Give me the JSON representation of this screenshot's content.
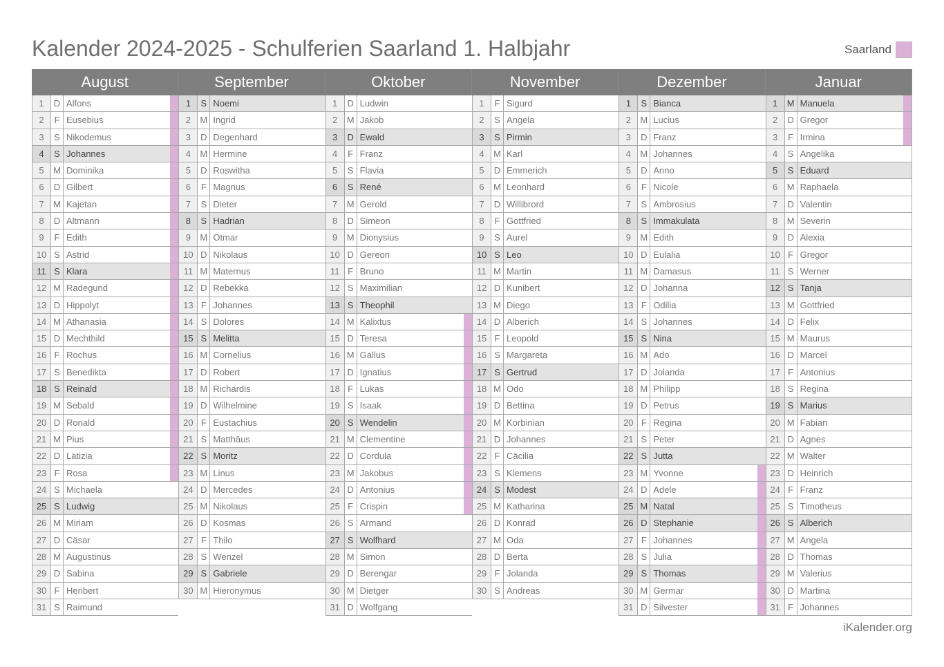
{
  "title": "Kalender 2024-2025 - Schulferien Saarland 1. Halbjahr",
  "legend": {
    "label": "Saarland",
    "color": "#dbb1d8"
  },
  "footer": "iKalender.org",
  "months": [
    {
      "name": "August",
      "days": [
        [
          "1",
          "D",
          "Alfons"
        ],
        [
          "2",
          "F",
          "Eusebius"
        ],
        [
          "3",
          "S",
          "Nikodemus"
        ],
        [
          "4",
          "S",
          "Johannes"
        ],
        [
          "5",
          "M",
          "Dominika"
        ],
        [
          "6",
          "D",
          "Gilbert"
        ],
        [
          "7",
          "M",
          "Kajetan"
        ],
        [
          "8",
          "D",
          "Altmann"
        ],
        [
          "9",
          "F",
          "Edith"
        ],
        [
          "10",
          "S",
          "Astrid"
        ],
        [
          "11",
          "S",
          "Klara"
        ],
        [
          "12",
          "M",
          "Radegund"
        ],
        [
          "13",
          "D",
          "Hippolyt"
        ],
        [
          "14",
          "M",
          "Athanasia"
        ],
        [
          "15",
          "D",
          "Mechthild"
        ],
        [
          "16",
          "F",
          "Rochus"
        ],
        [
          "17",
          "S",
          "Benedikta"
        ],
        [
          "18",
          "S",
          "Reinald"
        ],
        [
          "19",
          "M",
          "Sebald"
        ],
        [
          "20",
          "D",
          "Ronald"
        ],
        [
          "21",
          "M",
          "Pius"
        ],
        [
          "22",
          "D",
          "Lätizia"
        ],
        [
          "23",
          "F",
          "Rosa"
        ],
        [
          "24",
          "S",
          "Michaela"
        ],
        [
          "25",
          "S",
          "Ludwig"
        ],
        [
          "26",
          "M",
          "Miriam"
        ],
        [
          "27",
          "D",
          "Cäsar"
        ],
        [
          "28",
          "M",
          "Augustinus"
        ],
        [
          "29",
          "D",
          "Sabina"
        ],
        [
          "30",
          "F",
          "Heribert"
        ],
        [
          "31",
          "S",
          "Raimund"
        ]
      ],
      "gray": [
        4,
        11,
        18,
        25
      ],
      "holiday": [
        1,
        23
      ]
    },
    {
      "name": "September",
      "days": [
        [
          "1",
          "S",
          "Noemi"
        ],
        [
          "2",
          "M",
          "Ingrid"
        ],
        [
          "3",
          "D",
          "Degenhard"
        ],
        [
          "4",
          "M",
          "Hermine"
        ],
        [
          "5",
          "D",
          "Roswitha"
        ],
        [
          "6",
          "F",
          "Magnus"
        ],
        [
          "7",
          "S",
          "Dieter"
        ],
        [
          "8",
          "S",
          "Hadrian"
        ],
        [
          "9",
          "M",
          "Otmar"
        ],
        [
          "10",
          "D",
          "Nikolaus"
        ],
        [
          "11",
          "M",
          "Maternus"
        ],
        [
          "12",
          "D",
          "Rebekka"
        ],
        [
          "13",
          "F",
          "Johannes"
        ],
        [
          "14",
          "S",
          "Dolores"
        ],
        [
          "15",
          "S",
          "Melitta"
        ],
        [
          "16",
          "M",
          "Cornelius"
        ],
        [
          "17",
          "D",
          "Robert"
        ],
        [
          "18",
          "M",
          "Richardis"
        ],
        [
          "19",
          "D",
          "Wilhelmine"
        ],
        [
          "20",
          "F",
          "Eustachius"
        ],
        [
          "21",
          "S",
          "Matthäus"
        ],
        [
          "22",
          "S",
          "Moritz"
        ],
        [
          "23",
          "M",
          "Linus"
        ],
        [
          "24",
          "D",
          "Mercedes"
        ],
        [
          "25",
          "M",
          "Nikolaus"
        ],
        [
          "26",
          "D",
          "Kosmas"
        ],
        [
          "27",
          "F",
          "Thilo"
        ],
        [
          "28",
          "S",
          "Wenzel"
        ],
        [
          "29",
          "S",
          "Gabriele"
        ],
        [
          "30",
          "M",
          "Hieronymus"
        ]
      ],
      "gray": [
        1,
        8,
        15,
        22,
        29
      ],
      "holiday": null
    },
    {
      "name": "Oktober",
      "days": [
        [
          "1",
          "D",
          "Ludwin"
        ],
        [
          "2",
          "M",
          "Jakob"
        ],
        [
          "3",
          "D",
          "Ewald"
        ],
        [
          "4",
          "F",
          "Franz"
        ],
        [
          "5",
          "S",
          "Flavia"
        ],
        [
          "6",
          "S",
          "René"
        ],
        [
          "7",
          "M",
          "Gerold"
        ],
        [
          "8",
          "D",
          "Simeon"
        ],
        [
          "9",
          "M",
          "Dionysius"
        ],
        [
          "10",
          "D",
          "Gereon"
        ],
        [
          "11",
          "F",
          "Bruno"
        ],
        [
          "12",
          "S",
          "Maximilian"
        ],
        [
          "13",
          "S",
          "Theophil"
        ],
        [
          "14",
          "M",
          "Kalixtus"
        ],
        [
          "15",
          "D",
          "Teresa"
        ],
        [
          "16",
          "M",
          "Gallus"
        ],
        [
          "17",
          "D",
          "Ignatius"
        ],
        [
          "18",
          "F",
          "Lukas"
        ],
        [
          "19",
          "S",
          "Isaak"
        ],
        [
          "20",
          "S",
          "Wendelin"
        ],
        [
          "21",
          "M",
          "Clementine"
        ],
        [
          "22",
          "D",
          "Cordula"
        ],
        [
          "23",
          "M",
          "Jakobus"
        ],
        [
          "24",
          "D",
          "Antonius"
        ],
        [
          "25",
          "F",
          "Crispin"
        ],
        [
          "26",
          "S",
          "Armand"
        ],
        [
          "27",
          "S",
          "Wolfhard"
        ],
        [
          "28",
          "M",
          "Simon"
        ],
        [
          "29",
          "D",
          "Berengar"
        ],
        [
          "30",
          "M",
          "Dietger"
        ],
        [
          "31",
          "D",
          "Wolfgang"
        ]
      ],
      "gray": [
        3,
        6,
        13,
        20,
        27
      ],
      "holiday": [
        14,
        25
      ]
    },
    {
      "name": "November",
      "days": [
        [
          "1",
          "F",
          "Sigurd"
        ],
        [
          "2",
          "S",
          "Angela"
        ],
        [
          "3",
          "S",
          "Pirmin"
        ],
        [
          "4",
          "M",
          "Karl"
        ],
        [
          "5",
          "D",
          "Emmerich"
        ],
        [
          "6",
          "M",
          "Leonhard"
        ],
        [
          "7",
          "D",
          "Willibrord"
        ],
        [
          "8",
          "F",
          "Gottfried"
        ],
        [
          "9",
          "S",
          "Aurel"
        ],
        [
          "10",
          "S",
          "Leo"
        ],
        [
          "11",
          "M",
          "Martin"
        ],
        [
          "12",
          "D",
          "Kunibert"
        ],
        [
          "13",
          "M",
          "Diego"
        ],
        [
          "14",
          "D",
          "Alberich"
        ],
        [
          "15",
          "F",
          "Leopold"
        ],
        [
          "16",
          "S",
          "Margareta"
        ],
        [
          "17",
          "S",
          "Gertrud"
        ],
        [
          "18",
          "M",
          "Odo"
        ],
        [
          "19",
          "D",
          "Bettina"
        ],
        [
          "20",
          "M",
          "Korbinian"
        ],
        [
          "21",
          "D",
          "Johannes"
        ],
        [
          "22",
          "F",
          "Cäcilia"
        ],
        [
          "23",
          "S",
          "Klemens"
        ],
        [
          "24",
          "S",
          "Modest"
        ],
        [
          "25",
          "M",
          "Katharina"
        ],
        [
          "26",
          "D",
          "Konrad"
        ],
        [
          "27",
          "M",
          "Oda"
        ],
        [
          "28",
          "D",
          "Berta"
        ],
        [
          "29",
          "F",
          "Jolanda"
        ],
        [
          "30",
          "S",
          "Andreas"
        ]
      ],
      "gray": [
        3,
        10,
        17,
        24
      ],
      "holiday": null
    },
    {
      "name": "Dezember",
      "days": [
        [
          "1",
          "S",
          "Bianca"
        ],
        [
          "2",
          "M",
          "Lucius"
        ],
        [
          "3",
          "D",
          "Franz"
        ],
        [
          "4",
          "M",
          "Johannes"
        ],
        [
          "5",
          "D",
          "Anno"
        ],
        [
          "6",
          "F",
          "Nicole"
        ],
        [
          "7",
          "S",
          "Ambrosius"
        ],
        [
          "8",
          "S",
          "Immakulata"
        ],
        [
          "9",
          "M",
          "Edith"
        ],
        [
          "10",
          "D",
          "Eulalia"
        ],
        [
          "11",
          "M",
          "Damasus"
        ],
        [
          "12",
          "D",
          "Johanna"
        ],
        [
          "13",
          "F",
          "Odilia"
        ],
        [
          "14",
          "S",
          "Johannes"
        ],
        [
          "15",
          "S",
          "Nina"
        ],
        [
          "16",
          "M",
          "Ado"
        ],
        [
          "17",
          "D",
          "Jolanda"
        ],
        [
          "18",
          "M",
          "Philipp"
        ],
        [
          "19",
          "D",
          "Petrus"
        ],
        [
          "20",
          "F",
          "Regina"
        ],
        [
          "21",
          "S",
          "Peter"
        ],
        [
          "22",
          "S",
          "Jutta"
        ],
        [
          "23",
          "M",
          "Yvonne"
        ],
        [
          "24",
          "D",
          "Adele"
        ],
        [
          "25",
          "M",
          "Natal"
        ],
        [
          "26",
          "D",
          "Stephanie"
        ],
        [
          "27",
          "F",
          "Johannes"
        ],
        [
          "28",
          "S",
          "Julia"
        ],
        [
          "29",
          "S",
          "Thomas"
        ],
        [
          "30",
          "M",
          "Germar"
        ],
        [
          "31",
          "D",
          "Silvester"
        ]
      ],
      "gray": [
        1,
        8,
        15,
        22,
        25,
        26,
        29
      ],
      "holiday": [
        23,
        31
      ]
    },
    {
      "name": "Januar",
      "days": [
        [
          "1",
          "M",
          "Manuela"
        ],
        [
          "2",
          "D",
          "Gregor"
        ],
        [
          "3",
          "F",
          "Irmina"
        ],
        [
          "4",
          "S",
          "Angelika"
        ],
        [
          "5",
          "S",
          "Eduard"
        ],
        [
          "6",
          "M",
          "Raphaela"
        ],
        [
          "7",
          "D",
          "Valentin"
        ],
        [
          "8",
          "M",
          "Severin"
        ],
        [
          "9",
          "D",
          "Alexia"
        ],
        [
          "10",
          "F",
          "Gregor"
        ],
        [
          "11",
          "S",
          "Werner"
        ],
        [
          "12",
          "S",
          "Tanja"
        ],
        [
          "13",
          "M",
          "Gottfried"
        ],
        [
          "14",
          "D",
          "Felix"
        ],
        [
          "15",
          "M",
          "Maurus"
        ],
        [
          "16",
          "D",
          "Marcel"
        ],
        [
          "17",
          "F",
          "Antonius"
        ],
        [
          "18",
          "S",
          "Regina"
        ],
        [
          "19",
          "S",
          "Marius"
        ],
        [
          "20",
          "M",
          "Fabian"
        ],
        [
          "21",
          "D",
          "Agnes"
        ],
        [
          "22",
          "M",
          "Walter"
        ],
        [
          "23",
          "D",
          "Heinrich"
        ],
        [
          "24",
          "F",
          "Franz"
        ],
        [
          "25",
          "S",
          "Timotheus"
        ],
        [
          "26",
          "S",
          "Alberich"
        ],
        [
          "27",
          "M",
          "Angela"
        ],
        [
          "28",
          "D",
          "Thomas"
        ],
        [
          "29",
          "M",
          "Valerius"
        ],
        [
          "30",
          "D",
          "Martina"
        ],
        [
          "31",
          "F",
          "Johannes"
        ]
      ],
      "gray": [
        1,
        5,
        12,
        19,
        26
      ],
      "holiday": [
        1,
        3
      ]
    }
  ]
}
